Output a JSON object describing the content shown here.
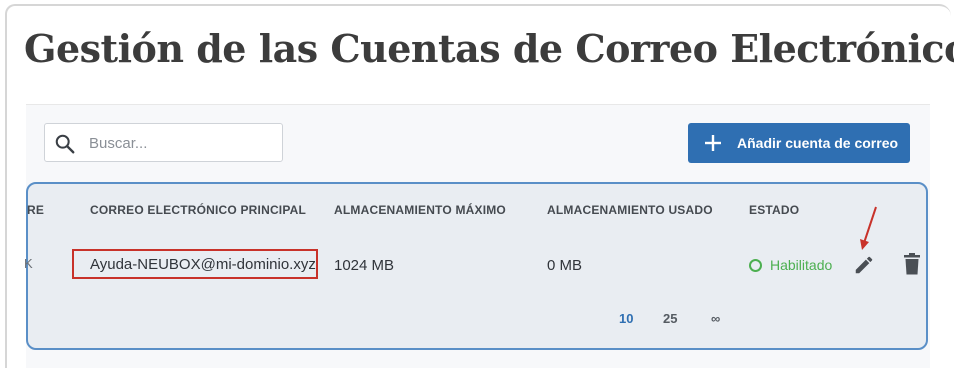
{
  "page": {
    "title": "Gestión de las Cuentas de Correo Electrónico"
  },
  "toolbar": {
    "search_placeholder": "Buscar...",
    "search_icon": "search-icon",
    "add_button_label": "Añadir cuenta de correo",
    "add_icon": "plus-icon"
  },
  "table": {
    "truncated_header": "RE",
    "columns": [
      "CORREO ELECTRÓNICO PRINCIPAL",
      "ALMACENAMIENTO MÁXIMO",
      "ALMACENAMIENTO USADO",
      "ESTADO"
    ],
    "rows": [
      {
        "truncated_cell": "K",
        "email": "Ayuda-NEUBOX@mi-dominio.xyz",
        "max_storage": "1024 MB",
        "used_storage": "0 MB",
        "status": "Habilitado",
        "actions": [
          "edit-icon",
          "trash-icon"
        ]
      }
    ]
  },
  "pagination": {
    "options": [
      "10",
      "25",
      "∞"
    ],
    "selected": "10"
  },
  "colors": {
    "primary": "#2f6fb2",
    "status_enabled": "#4caf50",
    "highlight_border": "#c8322a",
    "card_border": "#5a8fc7"
  }
}
